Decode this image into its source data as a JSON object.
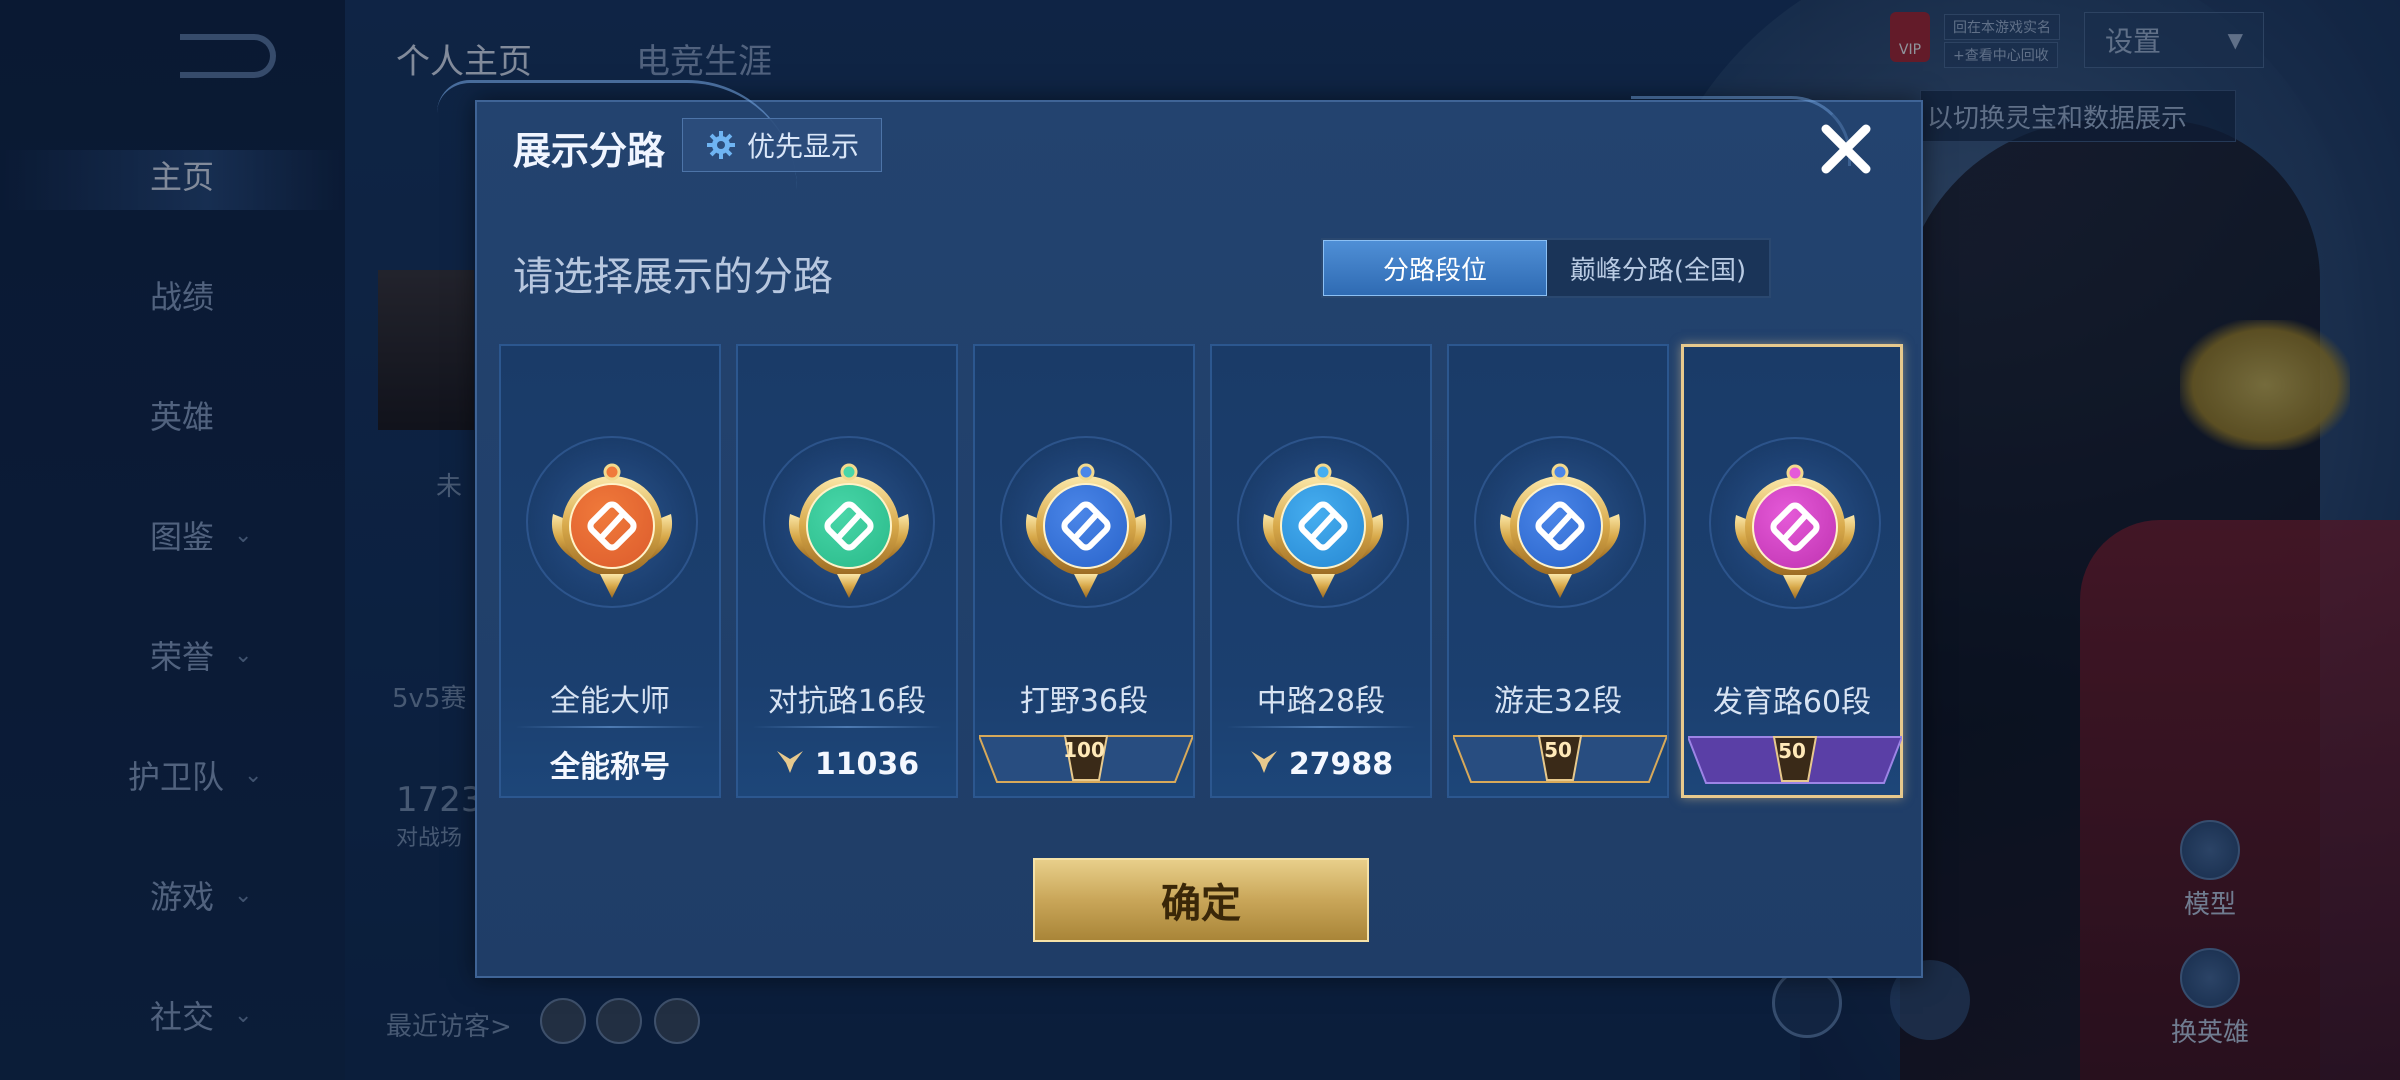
{
  "background": {
    "top_tabs": [
      "个人主页",
      "电竞生涯"
    ],
    "sidebar": [
      {
        "label": "主页",
        "has_chevron": false
      },
      {
        "label": "战绩",
        "has_chevron": false
      },
      {
        "label": "英雄",
        "has_chevron": false
      },
      {
        "label": "图鉴",
        "has_chevron": true
      },
      {
        "label": "荣誉",
        "has_chevron": true
      },
      {
        "label": "护卫队",
        "has_chevron": true
      },
      {
        "label": "游戏",
        "has_chevron": true
      },
      {
        "label": "社交",
        "has_chevron": true
      }
    ],
    "partial_texts": {
      "status": "未",
      "mode": "5v5赛",
      "number": "1723",
      "battle": "对战场"
    },
    "recent_visitors_label": "最近访客>",
    "vip_label": "VIP",
    "vip_link_1": "回在本游戏实名",
    "vip_link_2": "+查看中心回收",
    "settings_label": "设置",
    "hint_text": "以切换灵宝和数据展示",
    "right_actions": [
      "模型",
      "换英雄"
    ]
  },
  "modal": {
    "title": "展示分路",
    "priority_button": "优先显示",
    "subtitle": "请选择展示的分路",
    "toggle": [
      "分路段位",
      "巅峰分路(全国)"
    ],
    "toggle_active": 0,
    "confirm": "确定",
    "cards": [
      {
        "name": "全能大师",
        "footer_type": "text",
        "footer": "全能称号",
        "badge_color": "#e0612f",
        "inner_color": "#f07a3b",
        "selected": false
      },
      {
        "name": "对抗路16段",
        "footer_type": "score",
        "footer": "11036",
        "badge_color": "#2fbf8f",
        "inner_color": "#48d6a8",
        "selected": false
      },
      {
        "name": "打野36段",
        "footer_type": "ribbon",
        "footer": "100",
        "badge_color": "#2f6ad0",
        "inner_color": "#4b86e8",
        "selected": false
      },
      {
        "name": "中路28段",
        "footer_type": "score",
        "footer": "27988",
        "badge_color": "#2c8fd8",
        "inner_color": "#46aef0",
        "selected": false
      },
      {
        "name": "游走32段",
        "footer_type": "ribbon",
        "footer": "50",
        "badge_color": "#2f6ad0",
        "inner_color": "#4b86e8",
        "selected": false
      },
      {
        "name": "发育路60段",
        "footer_type": "ribbon-purple",
        "footer": "50",
        "badge_color": "#c63ab8",
        "inner_color": "#e55ad8",
        "selected": true
      }
    ]
  },
  "colors": {
    "accent_gold": "#e7c98d",
    "toggle_active": "#3f7fc8",
    "modal_bg": "#213f6b"
  }
}
